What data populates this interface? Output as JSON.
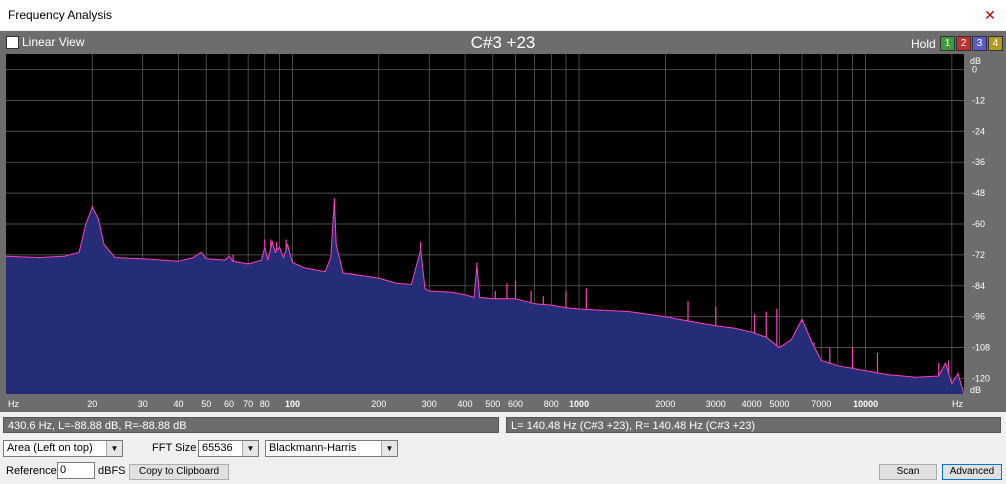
{
  "window": {
    "title": "Frequency Analysis"
  },
  "header": {
    "linear_view_label": "Linear View",
    "note": "C#3 +23",
    "hold_label": "Hold",
    "hold_buttons": [
      {
        "label": "1",
        "color": "#3c9a3c"
      },
      {
        "label": "2",
        "color": "#c03030"
      },
      {
        "label": "3",
        "color": "#5a5ad0"
      },
      {
        "label": "4",
        "color": "#b09a20"
      }
    ]
  },
  "colors": {
    "background": "#000000",
    "fill": "#252c78",
    "line": "#ff40c0",
    "grid": "#666666",
    "axis_text": "#ffffff",
    "panel": "#6d6d6d"
  },
  "chart_data": {
    "type": "area",
    "x_scale": "log",
    "x_unit": "Hz",
    "y_unit": "dB",
    "xlim": [
      10,
      22050
    ],
    "ylim": [
      -126,
      6
    ],
    "x_tick_labels": [
      {
        "value": 20,
        "text": "20"
      },
      {
        "value": 30,
        "text": "30"
      },
      {
        "value": 40,
        "text": "40"
      },
      {
        "value": 50,
        "text": "50"
      },
      {
        "value": 60,
        "text": "60"
      },
      {
        "value": 70,
        "text": "70"
      },
      {
        "value": 80,
        "text": "80"
      },
      {
        "value": 100,
        "text": "100",
        "bold": true
      },
      {
        "value": 200,
        "text": "200"
      },
      {
        "value": 300,
        "text": "300"
      },
      {
        "value": 400,
        "text": "400"
      },
      {
        "value": 500,
        "text": "500"
      },
      {
        "value": 600,
        "text": "600"
      },
      {
        "value": 800,
        "text": "800"
      },
      {
        "value": 1000,
        "text": "1000",
        "bold": true
      },
      {
        "value": 2000,
        "text": "2000"
      },
      {
        "value": 3000,
        "text": "3000"
      },
      {
        "value": 4000,
        "text": "4000"
      },
      {
        "value": 5000,
        "text": "5000"
      },
      {
        "value": 7000,
        "text": "7000"
      },
      {
        "value": 10000,
        "text": "10000",
        "bold": true
      }
    ],
    "x_grid": [
      20,
      30,
      40,
      50,
      60,
      70,
      80,
      90,
      100,
      200,
      300,
      400,
      500,
      600,
      700,
      800,
      900,
      1000,
      2000,
      3000,
      4000,
      5000,
      6000,
      7000,
      8000,
      9000,
      10000,
      20000
    ],
    "y_ticks": [
      0,
      -12,
      -24,
      -36,
      -48,
      -60,
      -72,
      -84,
      -96,
      -108,
      -120
    ],
    "y_tick_labels": [
      "0",
      "-12",
      "-24",
      "-36",
      "-48",
      "-60",
      "-72",
      "-84",
      "-96",
      "-108",
      "-120"
    ],
    "grid": true,
    "spectrum": [
      [
        10,
        -72.5
      ],
      [
        13,
        -73
      ],
      [
        16,
        -72.5
      ],
      [
        18,
        -71
      ],
      [
        19,
        -60
      ],
      [
        20,
        -53.5
      ],
      [
        21,
        -58
      ],
      [
        22,
        -68
      ],
      [
        24,
        -73
      ],
      [
        30,
        -73.5
      ],
      [
        40,
        -74.5
      ],
      [
        45,
        -73
      ],
      [
        48,
        -71
      ],
      [
        50,
        -73.5
      ],
      [
        58,
        -74
      ],
      [
        60,
        -72.5
      ],
      [
        62,
        -74.5
      ],
      [
        70,
        -75.5
      ],
      [
        78,
        -74
      ],
      [
        80,
        -69
      ],
      [
        82,
        -74
      ],
      [
        85,
        -67
      ],
      [
        87,
        -71
      ],
      [
        90,
        -69
      ],
      [
        93,
        -73
      ],
      [
        96,
        -68
      ],
      [
        100,
        -75
      ],
      [
        110,
        -77
      ],
      [
        130,
        -78.5
      ],
      [
        136,
        -73
      ],
      [
        140,
        -50.5
      ],
      [
        142,
        -68
      ],
      [
        150,
        -79
      ],
      [
        200,
        -81
      ],
      [
        230,
        -83
      ],
      [
        260,
        -83.5
      ],
      [
        280,
        -70
      ],
      [
        290,
        -85
      ],
      [
        300,
        -86
      ],
      [
        360,
        -86.5
      ],
      [
        400,
        -87.5
      ],
      [
        430,
        -88.5
      ],
      [
        440,
        -76
      ],
      [
        450,
        -88.5
      ],
      [
        500,
        -89
      ],
      [
        600,
        -89
      ],
      [
        700,
        -91
      ],
      [
        800,
        -91.5
      ],
      [
        900,
        -92.5
      ],
      [
        1000,
        -93
      ],
      [
        1500,
        -94
      ],
      [
        2000,
        -96
      ],
      [
        2500,
        -98
      ],
      [
        3000,
        -99.5
      ],
      [
        3500,
        -100.5
      ],
      [
        4000,
        -102
      ],
      [
        4500,
        -104
      ],
      [
        5000,
        -108
      ],
      [
        5500,
        -105
      ],
      [
        6000,
        -97
      ],
      [
        6500,
        -106
      ],
      [
        7000,
        -113
      ],
      [
        8000,
        -115
      ],
      [
        10000,
        -117
      ],
      [
        12000,
        -118.5
      ],
      [
        15000,
        -119.5
      ],
      [
        18000,
        -119
      ],
      [
        19000,
        -114
      ],
      [
        20000,
        -122
      ],
      [
        21000,
        -118
      ],
      [
        22050,
        -126
      ]
    ],
    "peaks": [
      [
        20,
        -53
      ],
      [
        62,
        -72
      ],
      [
        80,
        -66
      ],
      [
        84,
        -66
      ],
      [
        88,
        -67
      ],
      [
        95,
        -66
      ],
      [
        140,
        -50
      ],
      [
        280,
        -67
      ],
      [
        440,
        -75
      ],
      [
        510,
        -86
      ],
      [
        560,
        -83
      ],
      [
        600,
        -82
      ],
      [
        680,
        -86
      ],
      [
        750,
        -88
      ],
      [
        900,
        -86
      ],
      [
        1060,
        -85
      ],
      [
        2400,
        -90
      ],
      [
        3000,
        -92
      ],
      [
        4100,
        -95
      ],
      [
        4500,
        -94
      ],
      [
        4900,
        -93
      ],
      [
        6000,
        -98
      ],
      [
        6600,
        -106
      ],
      [
        7500,
        -108
      ],
      [
        9000,
        -108
      ],
      [
        11000,
        -110
      ],
      [
        18000,
        -114
      ],
      [
        19500,
        -113
      ]
    ]
  },
  "status": {
    "cursor": "430.6 Hz, L=-88.88 dB, R=-88.88 dB",
    "peak": "L= 140.48 Hz (C#3 +23), R= 140.48 Hz (C#3 +23)"
  },
  "controls": {
    "mode_select": "Area (Left on top)",
    "fft_size_label": "FFT Size",
    "fft_size": "65536",
    "window_select": "Blackmann-Harris",
    "reference_label": "Reference",
    "reference_value": "0",
    "dbfs_label": "dBFS",
    "copy_button": "Copy to Clipboard",
    "scan_button": "Scan",
    "advanced_button": "Advanced"
  }
}
